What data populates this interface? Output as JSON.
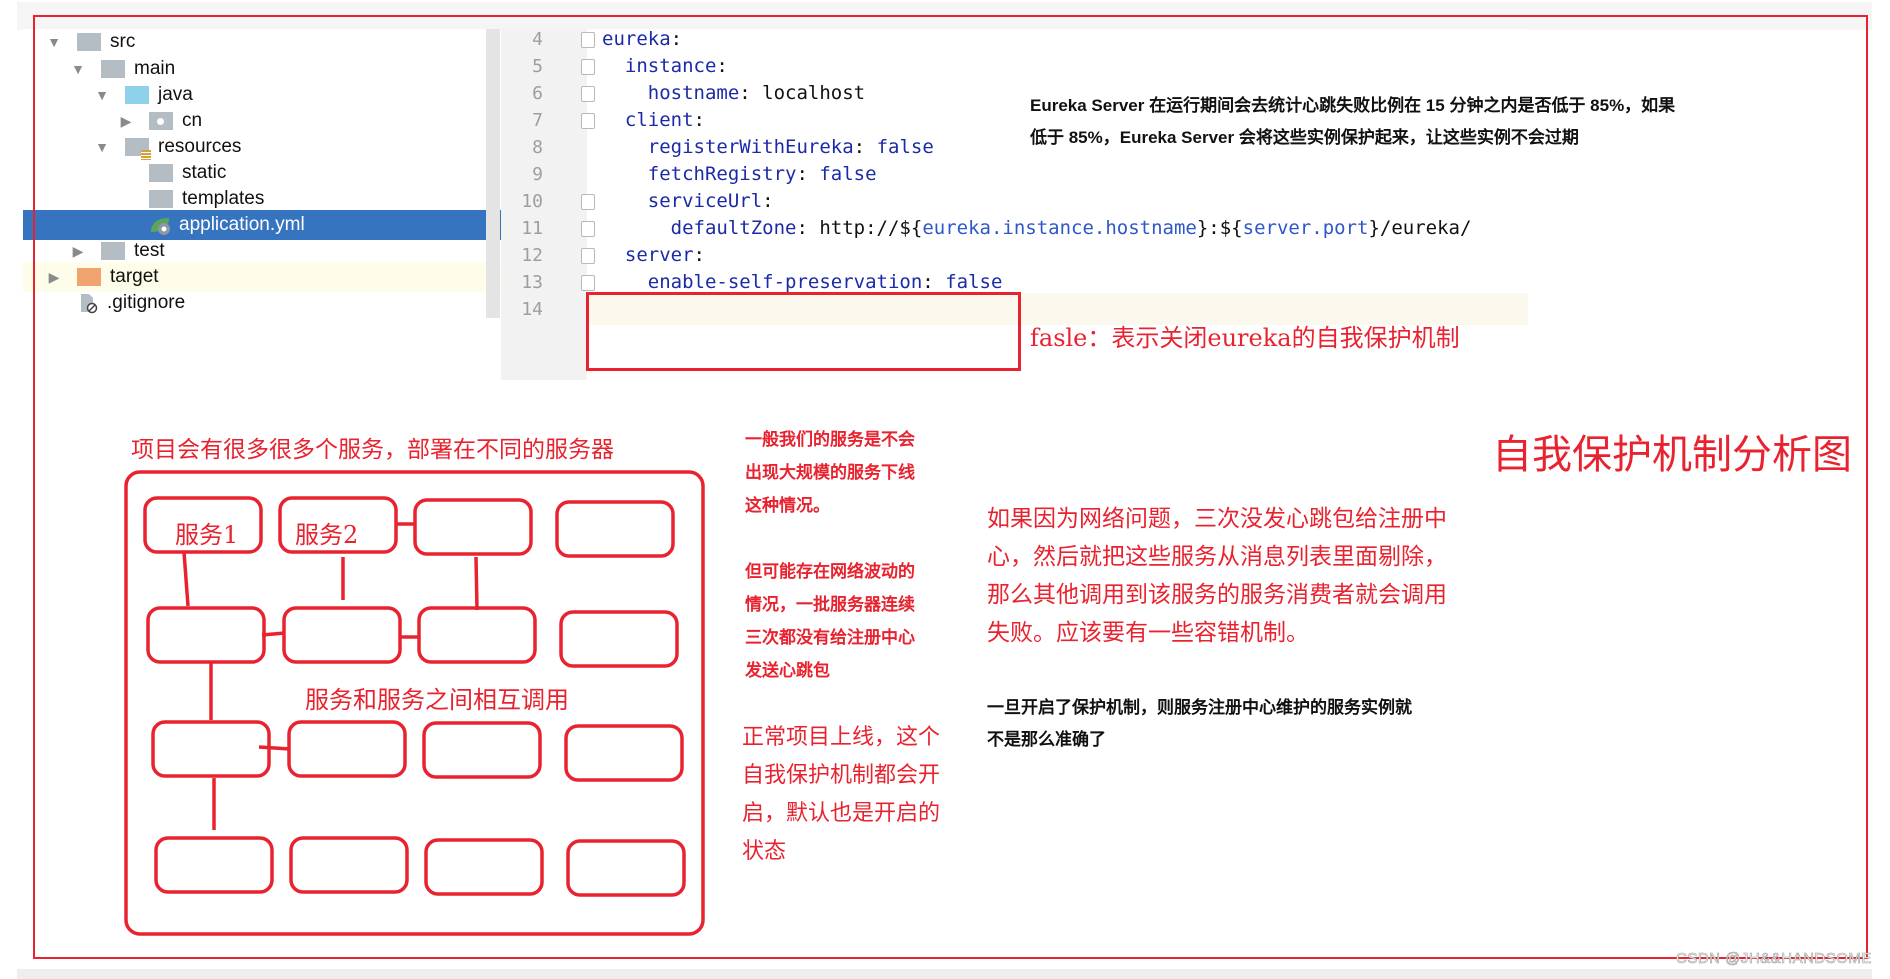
{
  "file_tree": {
    "items": [
      {
        "label": "src",
        "depth": 0,
        "expanded": true,
        "icon": "folder-grey"
      },
      {
        "label": "main",
        "depth": 1,
        "expanded": true,
        "icon": "folder-grey"
      },
      {
        "label": "java",
        "depth": 2,
        "expanded": true,
        "icon": "folder-blue"
      },
      {
        "label": "cn",
        "depth": 3,
        "expanded": false,
        "icon": "package-folder"
      },
      {
        "label": "resources",
        "depth": 2,
        "expanded": true,
        "icon": "resources-folder"
      },
      {
        "label": "static",
        "depth": 3,
        "icon": "folder-grey"
      },
      {
        "label": "templates",
        "depth": 3,
        "icon": "folder-grey"
      },
      {
        "label": "application.yml",
        "depth": 3,
        "icon": "spring-yml-file",
        "selected": true
      },
      {
        "label": "test",
        "depth": 1,
        "expanded": false,
        "icon": "folder-grey"
      },
      {
        "label": "target",
        "depth": 0,
        "expanded": false,
        "icon": "folder-orange"
      },
      {
        "label": ".gitignore",
        "depth": 0,
        "icon": "ignored-file"
      }
    ]
  },
  "editor": {
    "lines": [
      {
        "num": "4",
        "tokens": [
          {
            "t": "eureka",
            "c": "k"
          },
          {
            "t": ":",
            "c": "p"
          }
        ]
      },
      {
        "num": "5",
        "tokens": [
          {
            "t": "  instance",
            "c": "k"
          },
          {
            "t": ":",
            "c": "p"
          }
        ]
      },
      {
        "num": "6",
        "tokens": [
          {
            "t": "    hostname",
            "c": "k"
          },
          {
            "t": ": ",
            "c": "p"
          },
          {
            "t": "localhost",
            "c": "v"
          }
        ]
      },
      {
        "num": "7",
        "tokens": [
          {
            "t": "  client",
            "c": "k"
          },
          {
            "t": ":",
            "c": "p"
          }
        ]
      },
      {
        "num": "8",
        "tokens": [
          {
            "t": "    registerWithEureka",
            "c": "k"
          },
          {
            "t": ": ",
            "c": "p"
          },
          {
            "t": "false",
            "c": "k"
          }
        ]
      },
      {
        "num": "9",
        "tokens": [
          {
            "t": "    fetchRegistry",
            "c": "k"
          },
          {
            "t": ": ",
            "c": "p"
          },
          {
            "t": "false",
            "c": "k"
          }
        ]
      },
      {
        "num": "10",
        "tokens": [
          {
            "t": "    serviceUrl",
            "c": "k"
          },
          {
            "t": ":",
            "c": "p"
          }
        ]
      },
      {
        "num": "11",
        "tokens": [
          {
            "t": "      defaultZone",
            "c": "k"
          },
          {
            "t": ": http://${",
            "c": "v"
          },
          {
            "t": "eureka.instance.hostname",
            "c": "var"
          },
          {
            "t": "}:${",
            "c": "v"
          },
          {
            "t": "server.port",
            "c": "var"
          },
          {
            "t": "}/eureka/",
            "c": "v"
          }
        ]
      },
      {
        "num": "12",
        "tokens": [
          {
            "t": "  server",
            "c": "k"
          },
          {
            "t": ":",
            "c": "p"
          }
        ]
      },
      {
        "num": "13",
        "tokens": [
          {
            "t": "    enable-self-preservation",
            "c": "k"
          },
          {
            "t": ": ",
            "c": "p"
          },
          {
            "t": "false",
            "c": "k"
          }
        ]
      },
      {
        "num": "14",
        "tokens": []
      }
    ]
  },
  "annotations": {
    "eureka_note_line1": "Eureka Server 在运行期间会去统计心跳失败比例在 15 分钟之内是否低于 85%，如果",
    "eureka_note_line2": "低于 85%，Eureka Server 会将这些实例保护起来，让这些实例不会过期",
    "false_note": "fasle：表示关闭eureka的自我保护机制",
    "title": "自我保护机制分析图",
    "diagram_caption_top": "项目会有很多很多个服务，部署在不同的服务器",
    "diagram_caption_middle": "服务和服务之间相互调用",
    "service1": "服务1",
    "service2": "服务2",
    "bold_note_1": [
      "一般我们的服务是不会",
      "出现大规模的服务下线",
      "这种情况。"
    ],
    "bold_note_2": [
      "但可能存在网络波动的",
      "情况，一批服务器连续",
      "三次都没有给注册中心",
      "发送心跳包"
    ],
    "normal_note": [
      "正常项目上线，这个",
      "自我保护机制都会开",
      "启，默认也是开启的",
      "状态"
    ],
    "network_note": [
      "如果因为网络问题，三次没发心跳包给注册中",
      "心，然后就把这些服务从消息列表里面剔除，",
      "那么其他调用到该服务的服务消费者就会调用",
      "失败。应该要有一些容错机制。"
    ],
    "accuracy_note": [
      "一旦开启了保护机制，则服务注册中心维护的服务实例就",
      "不是那么准确了"
    ],
    "watermark": "CSDN @JH&&HANDSOME"
  },
  "colors": {
    "annotation_red": "#e8232f",
    "selection_blue": "#3774bf",
    "yaml_key": "#1b2aa6",
    "yaml_variable": "#2e57c9"
  }
}
